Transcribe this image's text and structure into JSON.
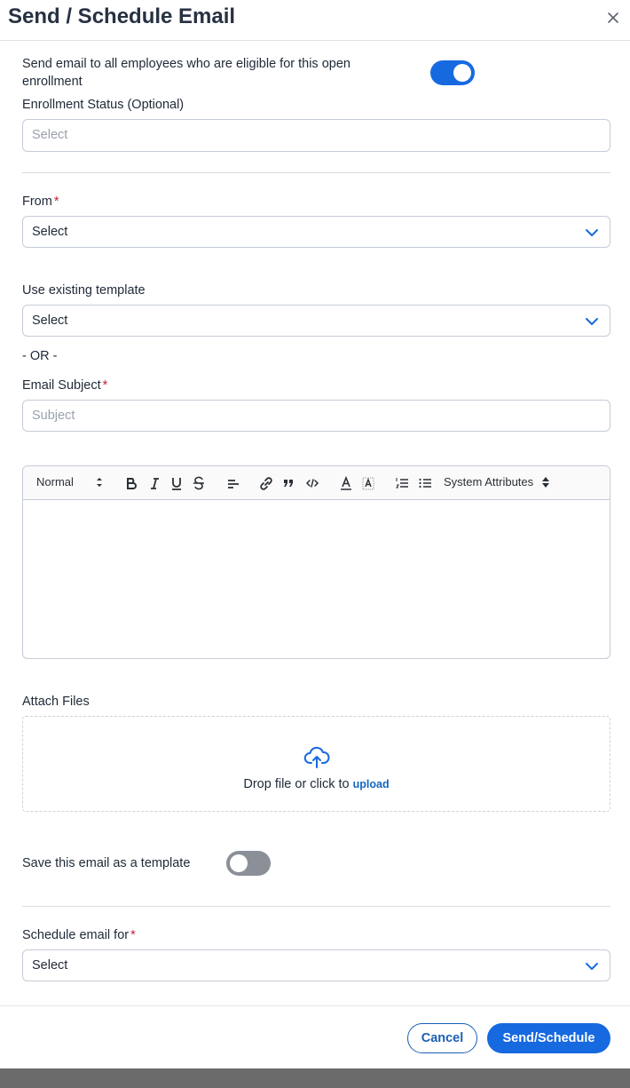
{
  "modal": {
    "title": "Send / Schedule Email"
  },
  "eligible_toggle": {
    "label_line1": "Send email to all employees who are eligible for this open",
    "label_line2": "enrollment",
    "state": "on"
  },
  "enrollment_status": {
    "label": "Enrollment Status (Optional)",
    "placeholder": "Select"
  },
  "from": {
    "label": "From",
    "required_mark": "*",
    "value": "Select"
  },
  "template": {
    "label": "Use existing template",
    "value": "Select"
  },
  "or_text": "- OR -",
  "subject": {
    "label": "Email Subject",
    "required_mark": "*",
    "placeholder": "Subject"
  },
  "editor": {
    "format_select": "Normal",
    "system_attributes": "System Attributes",
    "tool_icons": [
      "bold-icon",
      "italic-icon",
      "underline-icon",
      "strikethrough-icon",
      "align-icon",
      "link-icon",
      "blockquote-icon",
      "code-icon",
      "text-color-icon",
      "background-color-icon",
      "ordered-list-icon",
      "bullet-list-icon"
    ]
  },
  "attach": {
    "label": "Attach Files",
    "drop_text": "Drop file or click to",
    "upload_link": "upload",
    "icon": "cloud-upload-icon"
  },
  "save_template": {
    "label": "Save this email as a template",
    "state": "off"
  },
  "schedule": {
    "label": "Schedule email for",
    "required_mark": "*",
    "value": "Select"
  },
  "footer": {
    "cancel_label": "Cancel",
    "send_label": "Send/Schedule"
  },
  "colors": {
    "primary": "#1769e0",
    "required": "#c4213a",
    "link": "#1565c0"
  }
}
